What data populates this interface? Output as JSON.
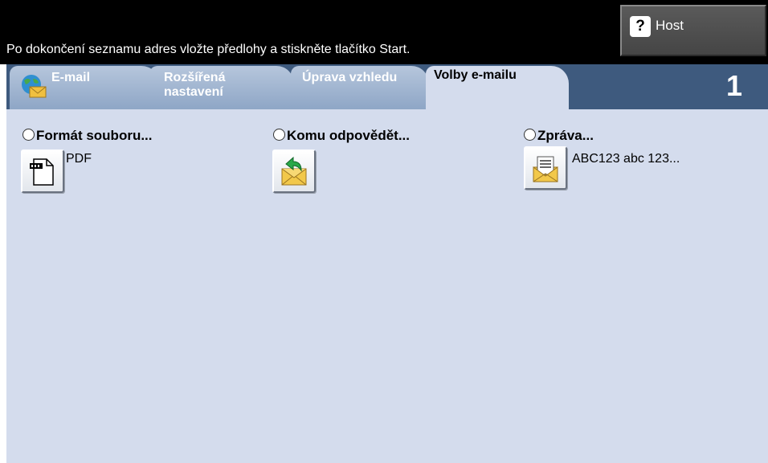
{
  "header": {
    "instruction": "Po dokončení seznamu adres vložte předlohy a stiskněte tlačítko Start.",
    "host_label": "Host",
    "host_icon": "question-icon"
  },
  "tabs": [
    {
      "line1": "E-mail",
      "line2": "",
      "icon": "globe-envelope-icon"
    },
    {
      "line1": "Rozšířená",
      "line2": "nastavení"
    },
    {
      "line1": "Úprava vzhledu",
      "line2": ""
    },
    {
      "line1": "Volby e-mailu",
      "line2": "",
      "active": true
    }
  ],
  "page_number": "1",
  "options": {
    "file_format": {
      "title": "Formát souboru...",
      "value": "PDF",
      "icon": "pdf-document-icon"
    },
    "reply_to": {
      "title": "Komu odpovědět...",
      "icon": "reply-envelope-icon"
    },
    "message": {
      "title": "Zpráva...",
      "value": "ABC123 abc 123...",
      "icon": "message-envelope-icon"
    }
  },
  "colors": {
    "header": "#000000",
    "tab_bar": "#3e5a7e",
    "active_tab": "#d4dced",
    "inactive_tab": "#a0b4d0",
    "content_bg": "#d4dced"
  }
}
